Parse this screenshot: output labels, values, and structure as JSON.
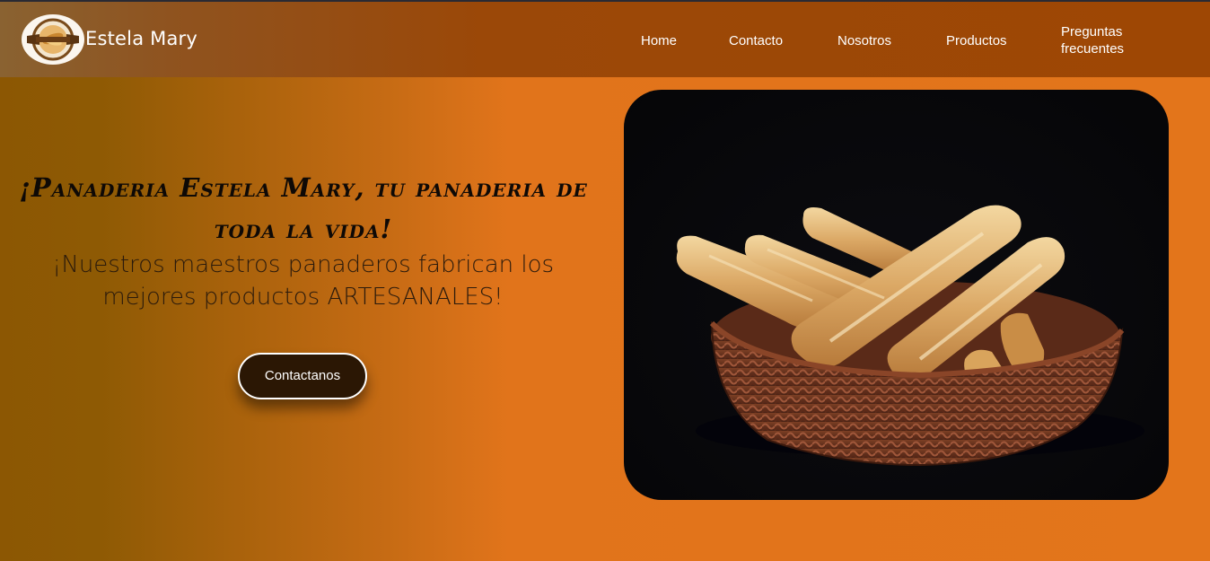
{
  "brand": {
    "name": "Estela Mary",
    "logo_icon": "bakery-logo-icon"
  },
  "nav": {
    "items": [
      {
        "label": "Home"
      },
      {
        "label": "Contacto"
      },
      {
        "label": "Nosotros"
      },
      {
        "label": "Productos"
      },
      {
        "label": "Preguntas frecuentes"
      }
    ]
  },
  "hero": {
    "title": "¡Panaderia Estela Mary, tu panaderia de toda la vida!",
    "subtitle": "¡Nuestros maestros panaderos fabrican los mejores productos ARTESANALES!",
    "cta_label": "Contactanos"
  },
  "colors": {
    "navbar": "#9e4704",
    "hero_orange": "#e3751b",
    "hero_brown": "#8c5703",
    "button_bg": "#2b1704",
    "text_dark": "#0e0906"
  }
}
